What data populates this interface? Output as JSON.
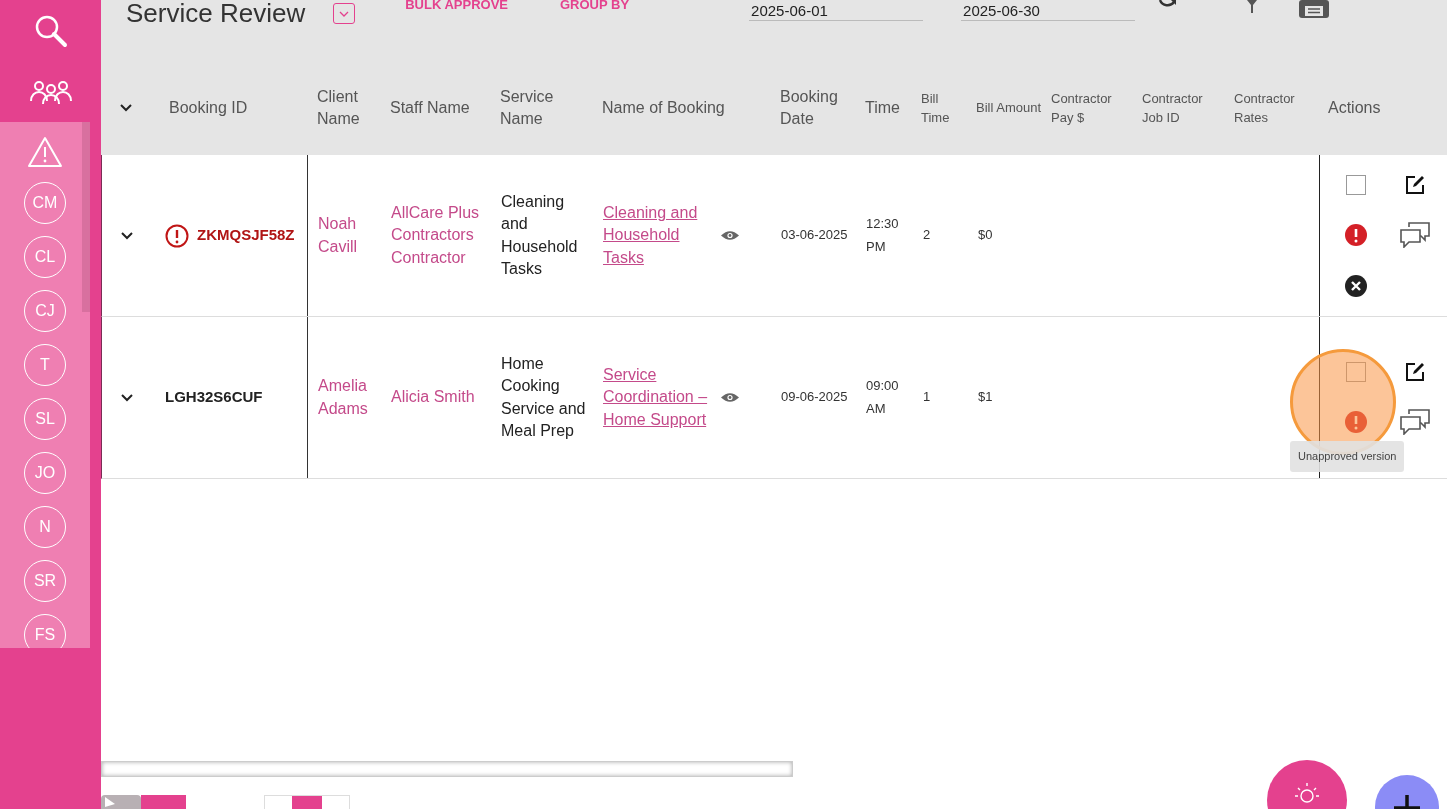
{
  "sidebar": {
    "avatars": [
      "CM",
      "CL",
      "CJ",
      "T",
      "SL",
      "JO",
      "N",
      "SR",
      "FS"
    ]
  },
  "toolbar": {
    "title": "Service Review",
    "buttons": [
      "BULK APPROVE",
      "GROUP BY"
    ],
    "date_from": "2025-06-01",
    "date_to": "2025-06-30"
  },
  "table": {
    "columns": [
      "Booking ID",
      "Client Name",
      "Staff Name",
      "Service Name",
      "Name of Booking",
      "Booking Date",
      "Time",
      "Bill Time",
      "Bill Amount",
      "Contractor Pay $",
      "Contractor Job ID",
      "Contractor Rates",
      "Actions"
    ],
    "rows": [
      {
        "booking_id": "ZKMQSJF58Z",
        "flagged": true,
        "client": "Noah Cavill",
        "staff": "AllCare Plus Contractors Contractor",
        "service": "Cleaning and Household Tasks",
        "booking_name": "Cleaning and Household Tasks",
        "date": "03-06-2025",
        "time": "12:30 PM",
        "bill_time": "2",
        "bill_amount": "$0",
        "checked": false,
        "cancellable": true
      },
      {
        "booking_id": "LGH32S6CUF",
        "flagged": false,
        "client": "Amelia Adams",
        "staff": "Alicia Smith",
        "service": "Home Cooking Service and Meal Prep",
        "booking_name": "Service Coordination – Home Support",
        "date": "09-06-2025",
        "time": "09:00 AM",
        "bill_time": "1",
        "bill_amount": "$1",
        "checked": false,
        "cancellable": false,
        "tooltip": "Unapproved version"
      }
    ]
  }
}
